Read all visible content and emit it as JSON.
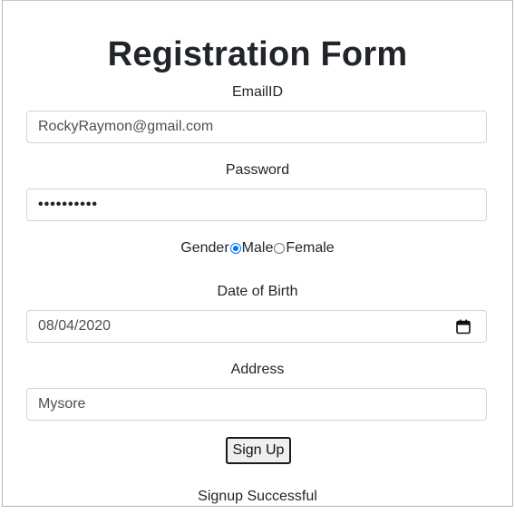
{
  "form": {
    "title": "Registration Form",
    "email": {
      "label": "EmailID",
      "value": "RockyRaymon@gmail.com"
    },
    "password": {
      "label": "Password",
      "masked_value": "••••••••••"
    },
    "gender": {
      "label": "Gender",
      "options": [
        {
          "label": "Male",
          "checked": true
        },
        {
          "label": "Female",
          "checked": false
        }
      ]
    },
    "dob": {
      "label": "Date of Birth",
      "value": "08/04/2020",
      "icon": "calendar-icon"
    },
    "address": {
      "label": "Address",
      "value": "Mysore"
    },
    "submit_label": "Sign Up",
    "status_message": "Signup Successful"
  },
  "colors": {
    "accent": "#0075ff",
    "border": "#ced4da",
    "text": "#212529"
  }
}
